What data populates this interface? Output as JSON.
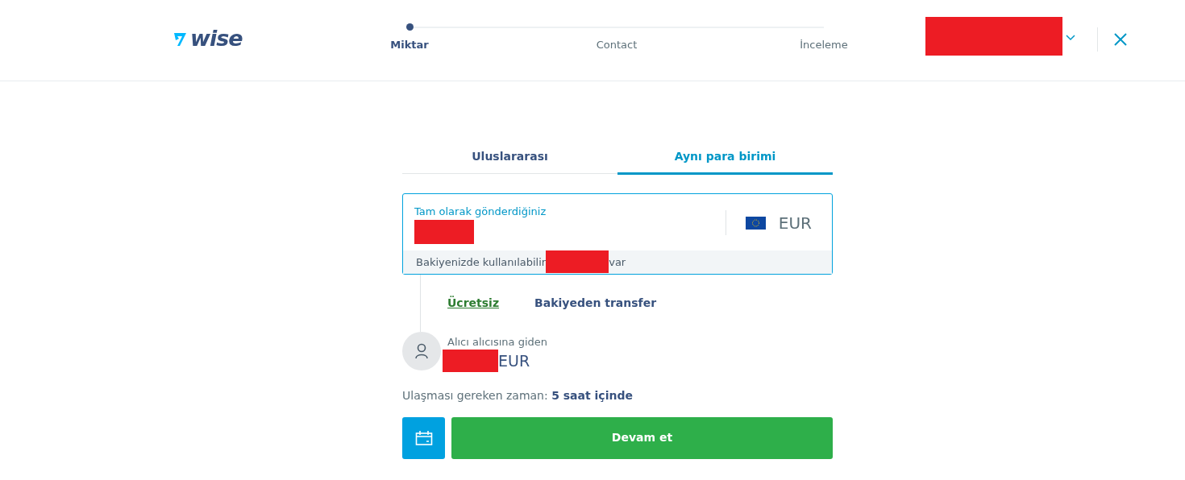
{
  "logo": {
    "text": "wise"
  },
  "steps": [
    {
      "label": "Miktar",
      "selected": true
    },
    {
      "label": "Contact",
      "selected": false
    },
    {
      "label": "İnceleme",
      "selected": false
    }
  ],
  "account_menu": {
    "redacted": true
  },
  "tabs": [
    {
      "label": "Uluslararası",
      "selected": false
    },
    {
      "label": "Aynı para birimi",
      "selected": true
    }
  ],
  "amount_field": {
    "label": "Tam olarak gönderdiğiniz",
    "redacted": true,
    "currency": "EUR",
    "balance_before": "Bakiyenizde kullanılabilir",
    "balance_redacted": true,
    "balance_after": "var"
  },
  "fee": {
    "amount": "Ücretsiz",
    "label": "Bakiyeden transfer"
  },
  "recipient": {
    "label": "Alıcı alıcısına giden",
    "redacted": true,
    "currency": "EUR"
  },
  "arrival": {
    "label": "Ulaşması gereken zaman:",
    "value": "5 saat içinde"
  },
  "continue_button": "Devam et"
}
